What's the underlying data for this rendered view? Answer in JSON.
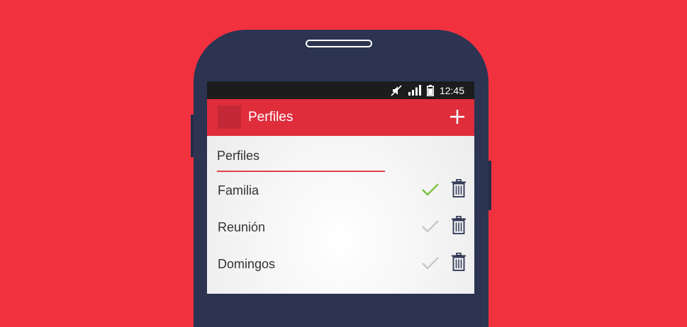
{
  "colors": {
    "background": "#F2313F",
    "phone_body": "#2C3452",
    "app_bar": "#DF2D3C",
    "accent_underline": "#E2404D",
    "check_active": "#7CC242",
    "check_inactive": "#C8C8C8",
    "trash": "#2C3452"
  },
  "status_bar": {
    "time": "12:45",
    "icons": [
      "mute-icon",
      "signal-icon",
      "battery-icon"
    ]
  },
  "app_bar": {
    "title": "Perfiles",
    "add_icon": "plus-icon"
  },
  "section": {
    "header": "Perfiles"
  },
  "profiles": [
    {
      "name": "Familia",
      "active": true
    },
    {
      "name": "Reunión",
      "active": false
    },
    {
      "name": "Domingos",
      "active": false
    }
  ]
}
